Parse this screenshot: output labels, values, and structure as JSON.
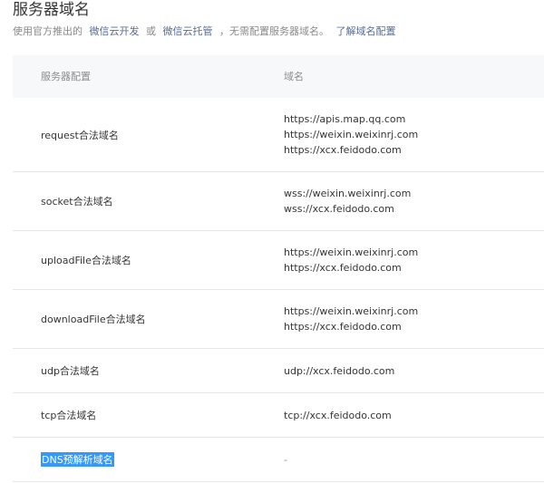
{
  "header": {
    "title": "服务器域名",
    "desc_prefix": "使用官方推出的",
    "link_cloudbase": "微信云开发",
    "desc_or": "或",
    "link_hosting": "微信云托管",
    "desc_suffix": "，无需配置服务器域名。",
    "link_learn": "了解域名配置"
  },
  "table": {
    "columns": [
      "服务器配置",
      "域名"
    ],
    "rows": [
      {
        "label": "request合法域名",
        "domains": [
          "https://apis.map.qq.com",
          "https://weixin.weixinrj.com",
          "https://xcx.feidodo.com"
        ]
      },
      {
        "label": "socket合法域名",
        "domains": [
          "wss://weixin.weixinrj.com",
          "wss://xcx.feidodo.com"
        ]
      },
      {
        "label": "uploadFile合法域名",
        "domains": [
          "https://weixin.weixinrj.com",
          "https://xcx.feidodo.com"
        ]
      },
      {
        "label": "downloadFile合法域名",
        "domains": [
          "https://weixin.weixinrj.com",
          "https://xcx.feidodo.com"
        ]
      },
      {
        "label": "udp合法域名",
        "domains": [
          "udp://xcx.feidodo.com"
        ]
      },
      {
        "label": "tcp合法域名",
        "domains": [
          "tcp://xcx.feidodo.com"
        ]
      },
      {
        "label": "DNS预解析域名",
        "domains": [
          "-"
        ]
      }
    ]
  }
}
